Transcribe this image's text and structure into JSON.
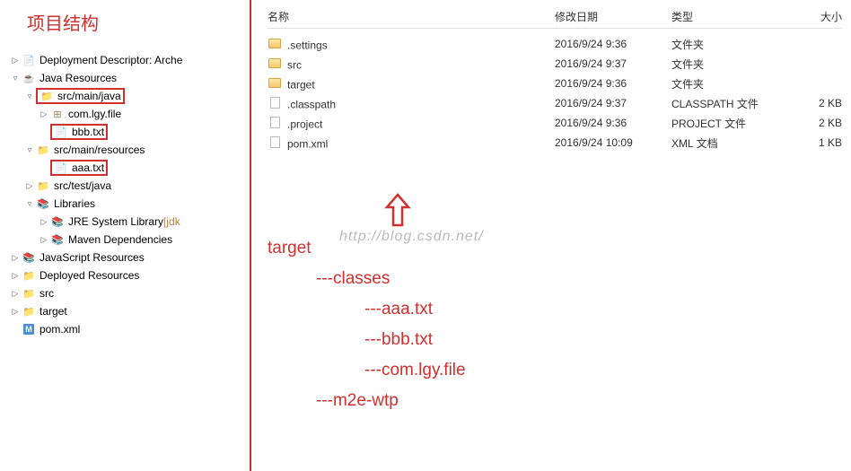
{
  "title": "项目结构",
  "tree": {
    "deploy": "Deployment Descriptor: Arche",
    "java_res": "Java Resources",
    "src_main_java": "src/main/java",
    "pkg": "com.lgy.file",
    "bbb": "bbb.txt",
    "src_main_res": "src/main/resources",
    "aaa": "aaa.txt",
    "src_test_java": "src/test/java",
    "libraries": "Libraries",
    "jre": "JRE System Library",
    "jre_suffix": " [jdk",
    "maven": "Maven Dependencies",
    "js_res": "JavaScript Resources",
    "deployed": "Deployed Resources",
    "src": "src",
    "target": "target",
    "pom": "pom.xml"
  },
  "explorer": {
    "headers": {
      "name": "名称",
      "date": "修改日期",
      "type": "类型",
      "size": "大小"
    },
    "rows": [
      {
        "name": ".settings",
        "date": "2016/9/24 9:36",
        "type": "文件夹",
        "size": "",
        "icon": "folder"
      },
      {
        "name": "src",
        "date": "2016/9/24 9:37",
        "type": "文件夹",
        "size": "",
        "icon": "folder"
      },
      {
        "name": "target",
        "date": "2016/9/24 9:36",
        "type": "文件夹",
        "size": "",
        "icon": "folder"
      },
      {
        "name": ".classpath",
        "date": "2016/9/24 9:37",
        "type": "CLASSPATH 文件",
        "size": "2 KB",
        "icon": "file"
      },
      {
        "name": ".project",
        "date": "2016/9/24 9:36",
        "type": "PROJECT 文件",
        "size": "2 KB",
        "icon": "file"
      },
      {
        "name": "pom.xml",
        "date": "2016/9/24 10:09",
        "type": "XML 文档",
        "size": "1 KB",
        "icon": "xml"
      }
    ]
  },
  "watermark": "http://blog.csdn.net/",
  "target_tree": {
    "l0": "target",
    "l1": "---classes",
    "l2a": "---aaa.txt",
    "l2b": "---bbb.txt",
    "l2c": "---com.lgy.file",
    "l1b": "---m2e-wtp"
  }
}
